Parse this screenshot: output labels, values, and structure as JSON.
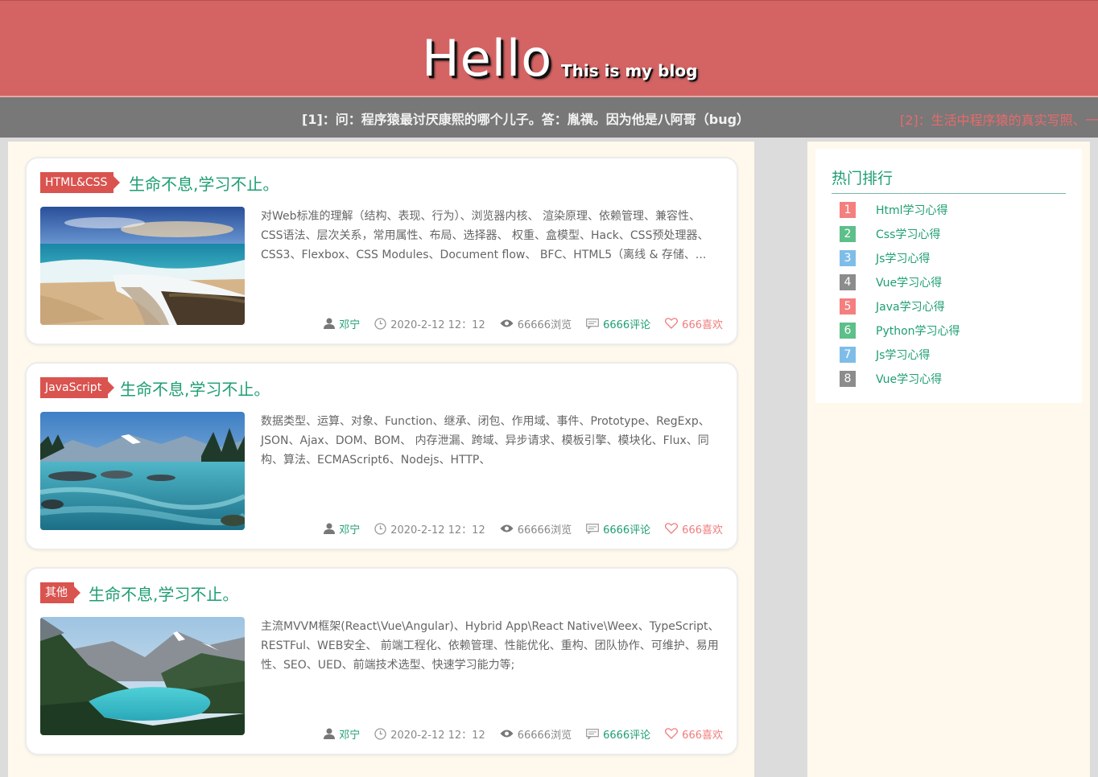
{
  "header": {
    "title": "Hello",
    "subtitle": "This is my blog"
  },
  "ticker": {
    "item1": "[1]：问：程序猿最讨厌康熙的哪个儿子。答：胤禩。因为他是八阿哥（bug）",
    "item2": "[2]：生活中程序猿的真实写照、一"
  },
  "posts": [
    {
      "tag": "HTML&CSS",
      "title": "生命不息,学习不止。",
      "description": "对Web标准的理解（结构、表现、行为）、浏览器内核、 渲染原理、依赖管理、兼容性、CSS语法、层次关系，常用属性、布局、选择器、 权重、盒模型、Hack、CSS预处理器、CSS3、Flexbox、CSS Modules、Document flow、 BFC、HTML5（离线 & 存储、...",
      "author": "邓宁",
      "date": "2020-2-12 12：12",
      "views": "66666浏览",
      "comments": "6666评论",
      "likes": "666喜欢",
      "image": "beach-waterfall-photo"
    },
    {
      "tag": "JavaScript",
      "title": "生命不息,学习不止。",
      "description": "数据类型、运算、对象、Function、继承、闭包、作用域、事件、Prototype、RegExp、JSON、Ajax、DOM、BOM、 内存泄漏、跨域、异步请求、模板引擎、模块化、Flux、同构、算法、ECMAScript6、Nodejs、HTTP、",
      "author": "邓宁",
      "date": "2020-2-12 12：12",
      "views": "66666浏览",
      "comments": "6666评论",
      "likes": "666喜欢",
      "image": "mountain-river-photo"
    },
    {
      "tag": "其他",
      "title": "生命不息,学习不止。",
      "description": "主流MVVM框架(React\\Vue\\Angular)、Hybrid App\\React Native\\Weex、TypeScript、RESTFul、WEB安全、 前端工程化、依赖管理、性能优化、重构、团队协作、可维护、易用性、SEO、UED、前端技术选型、快速学习能力等;",
      "author": "邓宁",
      "date": "2020-2-12 12：12",
      "views": "66666浏览",
      "comments": "6666评论",
      "likes": "666喜欢",
      "image": "mountain-lake-photo"
    }
  ],
  "sidebar": {
    "title": "热门排行",
    "items": [
      {
        "num": "1",
        "label": "Html学习心得",
        "color": "#f47f7f"
      },
      {
        "num": "2",
        "label": "Css学习心得",
        "color": "#5dbf8a"
      },
      {
        "num": "3",
        "label": "Js学习心得",
        "color": "#7fbde9"
      },
      {
        "num": "4",
        "label": "Vue学习心得",
        "color": "#8c8c8c"
      },
      {
        "num": "5",
        "label": "Java学习心得",
        "color": "#f47f7f"
      },
      {
        "num": "6",
        "label": "Python学习心得",
        "color": "#5dbf8a"
      },
      {
        "num": "7",
        "label": "Js学习心得",
        "color": "#7fbde9"
      },
      {
        "num": "8",
        "label": "Vue学习心得",
        "color": "#8c8c8c"
      }
    ]
  }
}
